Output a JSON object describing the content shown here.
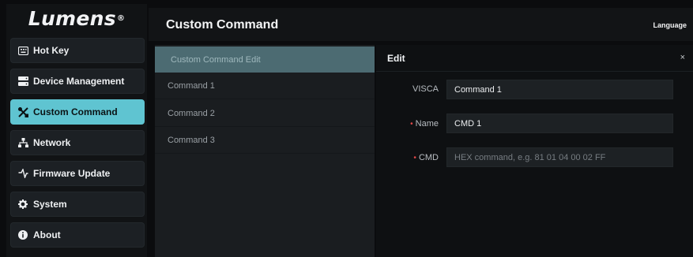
{
  "brand": {
    "name": "Lumens",
    "mark": "®"
  },
  "sidebar": {
    "items": [
      {
        "label": "Hot Key",
        "icon": "keyboard-icon",
        "active": false
      },
      {
        "label": "Device Management",
        "icon": "server-icon",
        "active": false
      },
      {
        "label": "Custom Command",
        "icon": "tools-icon",
        "active": true
      },
      {
        "label": "Network",
        "icon": "network-icon",
        "active": false
      },
      {
        "label": "Firmware Update",
        "icon": "firmware-icon",
        "active": false
      },
      {
        "label": "System",
        "icon": "gear-icon",
        "active": false
      },
      {
        "label": "About",
        "icon": "info-icon",
        "active": false
      }
    ]
  },
  "header": {
    "title": "Custom Command",
    "language": "Language"
  },
  "command_list": {
    "header": "Custom Command Edit",
    "items": [
      "Command 1",
      "Command 2",
      "Command 3"
    ]
  },
  "edit": {
    "title": "Edit",
    "close": "×",
    "fields": {
      "visca": {
        "label": "VISCA",
        "value": "Command 1",
        "required": false
      },
      "name": {
        "label": "Name",
        "value": "CMD 1",
        "required": true
      },
      "cmd": {
        "label": "CMD",
        "value": "",
        "placeholder": "HEX command, e.g. 81 01 04 00 02 FF",
        "required": true
      }
    }
  },
  "colors": {
    "accent": "#5fc4d1",
    "required": "#e04848",
    "list_header": "#4c6b72"
  }
}
